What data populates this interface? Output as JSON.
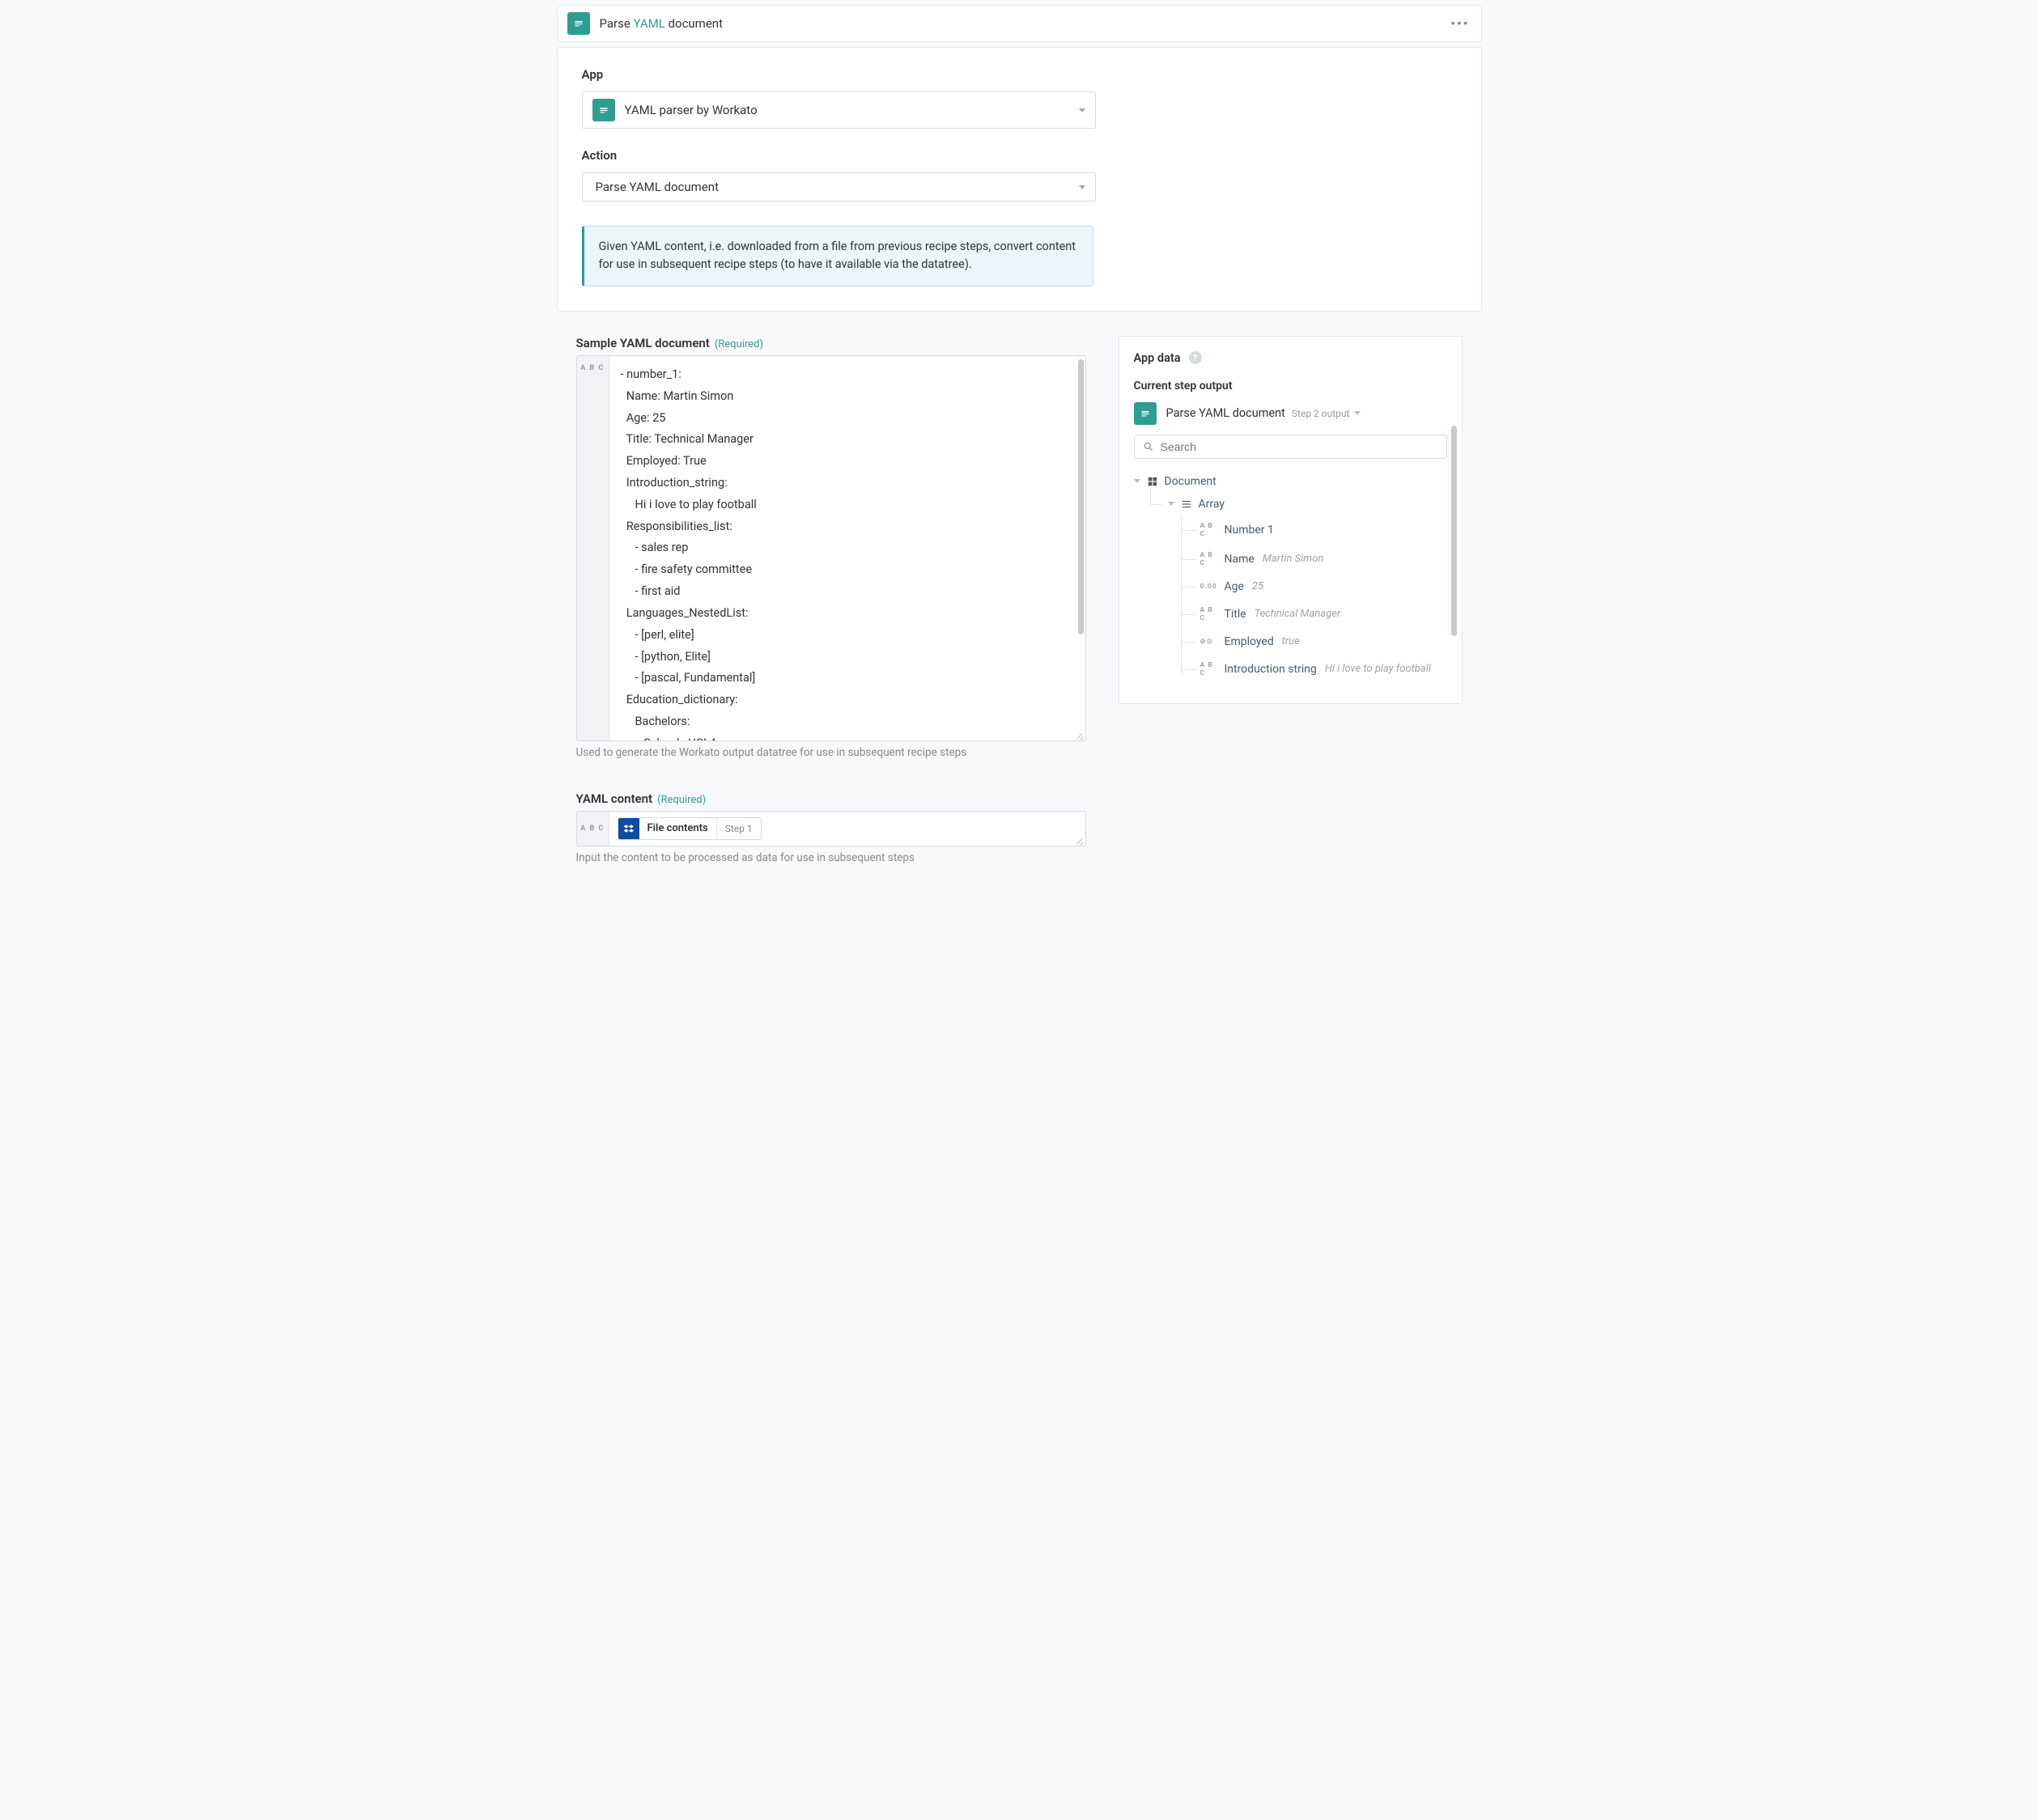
{
  "header": {
    "title_prefix": "Parse ",
    "title_link": "YAML",
    "title_suffix": " document"
  },
  "fields": {
    "app_label": "App",
    "app_value": "YAML parser by Workato",
    "action_label": "Action",
    "action_value": "Parse YAML document",
    "info_text": "Given YAML content, i.e. downloaded from a file from previous recipe steps, convert content for use in subsequent recipe steps (to have it available via the datatree)."
  },
  "sample": {
    "label": "Sample YAML document",
    "required": "(Required)",
    "gutter": "A B C",
    "content": "- number_1:\n  Name: Martin Simon\n  Age: 25\n  Title: Technical Manager\n  Employed: True\n  Introduction_string:\n     Hi i love to play football\n  Responsibilities_list:\n     - sales rep\n     - fire safety committee\n     - first aid\n  Languages_NestedList:\n     - [perl, elite]\n     - [python, Elite]\n     - [pascal, Fundamental]\n  Education_dictionary:\n     Bachelors:\n        School : UCLA",
    "helper": "Used to generate the Workato output datatree for use in subsequent recipe steps"
  },
  "yaml_content": {
    "label": "YAML content",
    "required": "(Required)",
    "gutter": "A B C",
    "pill_label": "File contents",
    "pill_step": "Step 1",
    "helper": "Input the content to be processed as data for use in subsequent steps"
  },
  "appdata": {
    "title": "App data",
    "current_step_output": "Current step output",
    "step_name": "Parse YAML document",
    "step_meta": "Step 2 output",
    "search_placeholder": "Search",
    "tree": {
      "document": "Document",
      "array": "Array",
      "leaves": [
        {
          "type": "A B C",
          "name": "Number 1",
          "value": ""
        },
        {
          "type": "A B C",
          "name": "Name",
          "value": "Martin Simon"
        },
        {
          "type": "0.00",
          "name": "Age",
          "value": "25"
        },
        {
          "type": "A B C",
          "name": "Title",
          "value": "Technical Manager"
        },
        {
          "type": "⊘⊙",
          "name": "Employed",
          "value": "true"
        },
        {
          "type": "A B C",
          "name": "Introduction string",
          "value": "Hi i love to play football"
        }
      ]
    }
  }
}
